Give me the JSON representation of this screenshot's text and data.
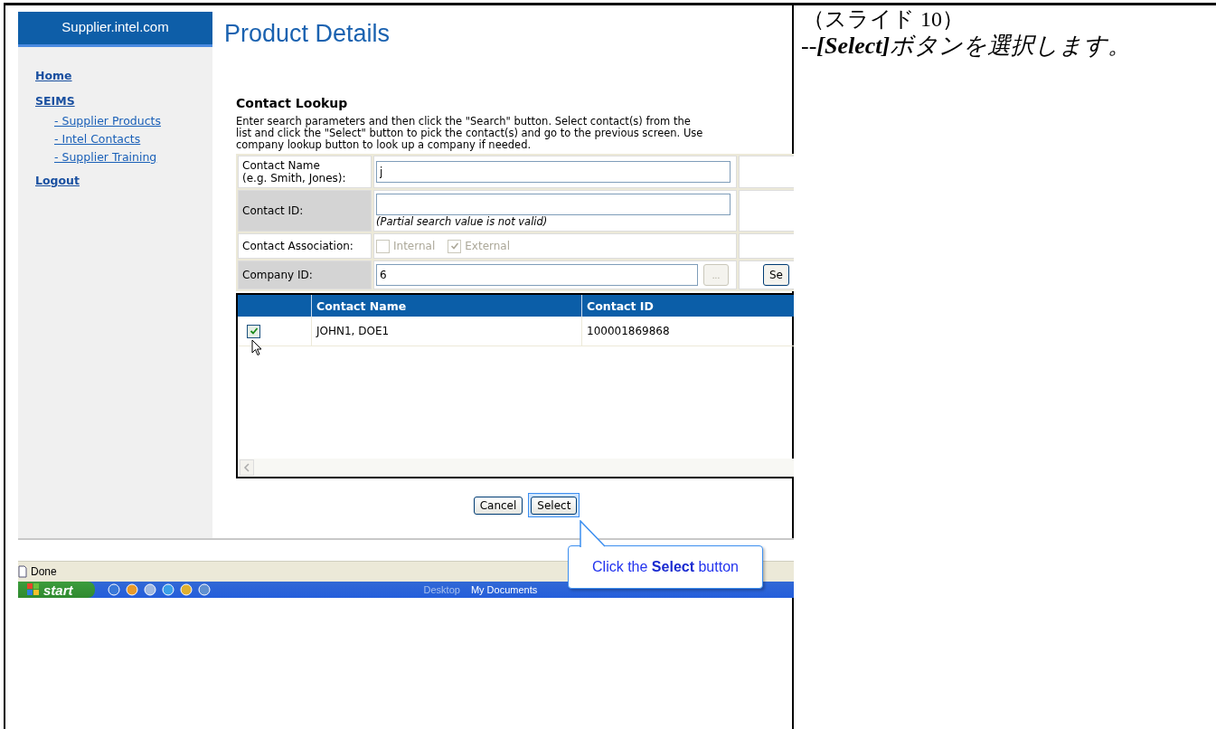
{
  "document": {
    "slide_label": "（スライド 10）",
    "instruction": "--**[Select]**ボタンを選択します。"
  },
  "site": {
    "brand": "Supplier.intel.com",
    "nav": [
      {
        "label": "Home"
      },
      {
        "label": "SEIMS",
        "children": [
          {
            "label": "- Supplier Products"
          },
          {
            "label": "- Intel Contacts"
          },
          {
            "label": "- Supplier Training"
          }
        ]
      },
      {
        "label": "Logout"
      }
    ]
  },
  "page_title": "Product Details",
  "lookup": {
    "title": "Contact Lookup",
    "description_lines": [
      "Enter search parameters and then click the \"Search\" button. Select contact(s) from the",
      "list and click the \"Select\" button to pick the contact(s) and go to the previous screen. Use",
      "company lookup button to look up a company if needed."
    ],
    "fields": [
      {
        "kind": "text",
        "label": "Contact Name\n(e.g. Smith, Jones):",
        "value": "j",
        "shaded": false
      },
      {
        "kind": "text",
        "label": "Contact ID:",
        "hint": "(Partial search value is not valid)",
        "shaded": true
      },
      {
        "kind": "checkboxes",
        "label": "Contact Association:",
        "shaded": false,
        "options": [
          {
            "label": "Internal",
            "checked": false,
            "disabled": true
          },
          {
            "label": "External",
            "checked": true,
            "disabled": true
          }
        ]
      },
      {
        "kind": "lookup",
        "label": "Company ID:",
        "value": "6",
        "shaded": true,
        "browse_button": "...",
        "search_button": "Se"
      }
    ]
  },
  "results": {
    "columns": [
      "Contact Name",
      "Contact ID"
    ],
    "rows": [
      {
        "checked": true,
        "name": "JOHN1, DOE1",
        "contact_id": "100001869868"
      }
    ]
  },
  "buttons": [
    {
      "label": "Cancel",
      "focused": false
    },
    {
      "label": "Select",
      "focused": true
    }
  ],
  "callout": "Click the **Select** button",
  "status_bar": {
    "text": "Done"
  },
  "taskbar": {
    "start": "start",
    "items": [
      {
        "label": "Desktop",
        "dim": true
      },
      {
        "label": "My Documents",
        "dim": false
      }
    ]
  }
}
